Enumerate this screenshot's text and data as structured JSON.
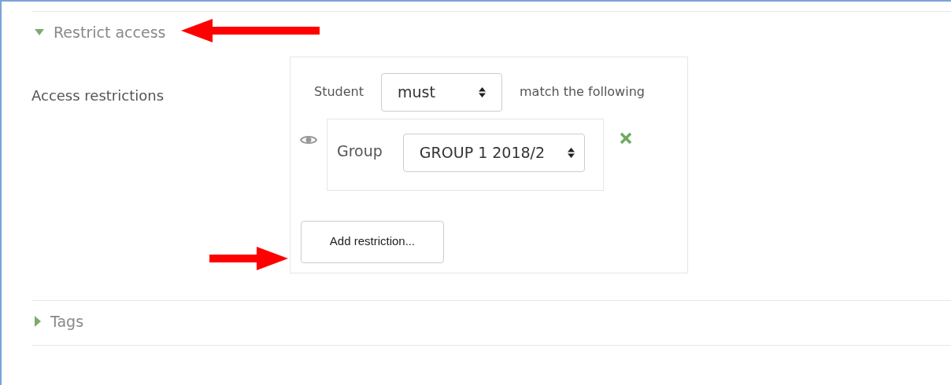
{
  "sections": [
    {
      "title": "Restrict access",
      "expanded": true,
      "field_label": "Access restrictions",
      "restrictions": {
        "prefix": "Student",
        "mode": "must",
        "suffix": "match the following",
        "conditions": [
          {
            "label": "Group",
            "value": "GROUP 1 2018/2"
          }
        ],
        "add_button": "Add restriction..."
      }
    },
    {
      "title": "Tags",
      "expanded": false
    }
  ]
}
